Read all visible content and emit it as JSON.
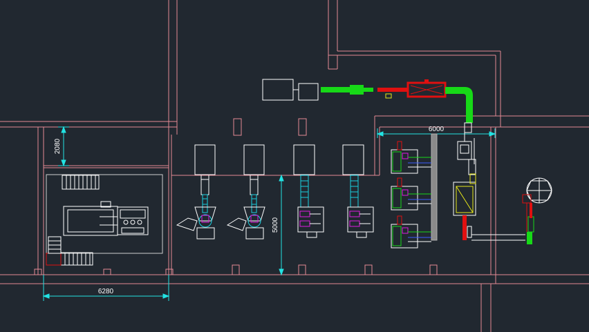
{
  "drawing": {
    "dimensions": [
      {
        "id": "dim-2080",
        "value": "2080"
      },
      {
        "id": "dim-5000",
        "value": "5000"
      },
      {
        "id": "dim-6000",
        "value": "6000"
      },
      {
        "id": "dim-6280",
        "value": "6280"
      }
    ],
    "colors": {
      "background": "#212830",
      "wall": "#e58a95",
      "equipment": "#ffffff",
      "dimension": "#22e3e3",
      "pipe_green": "#17d917",
      "pipe_red": "#e01010",
      "accent_cyan": "#19d1e0",
      "accent_magenta": "#e01ae0",
      "accent_yellow": "#e8e81a",
      "accent_blue": "#3a5cff",
      "rack_gray": "#8a8a8a"
    }
  }
}
